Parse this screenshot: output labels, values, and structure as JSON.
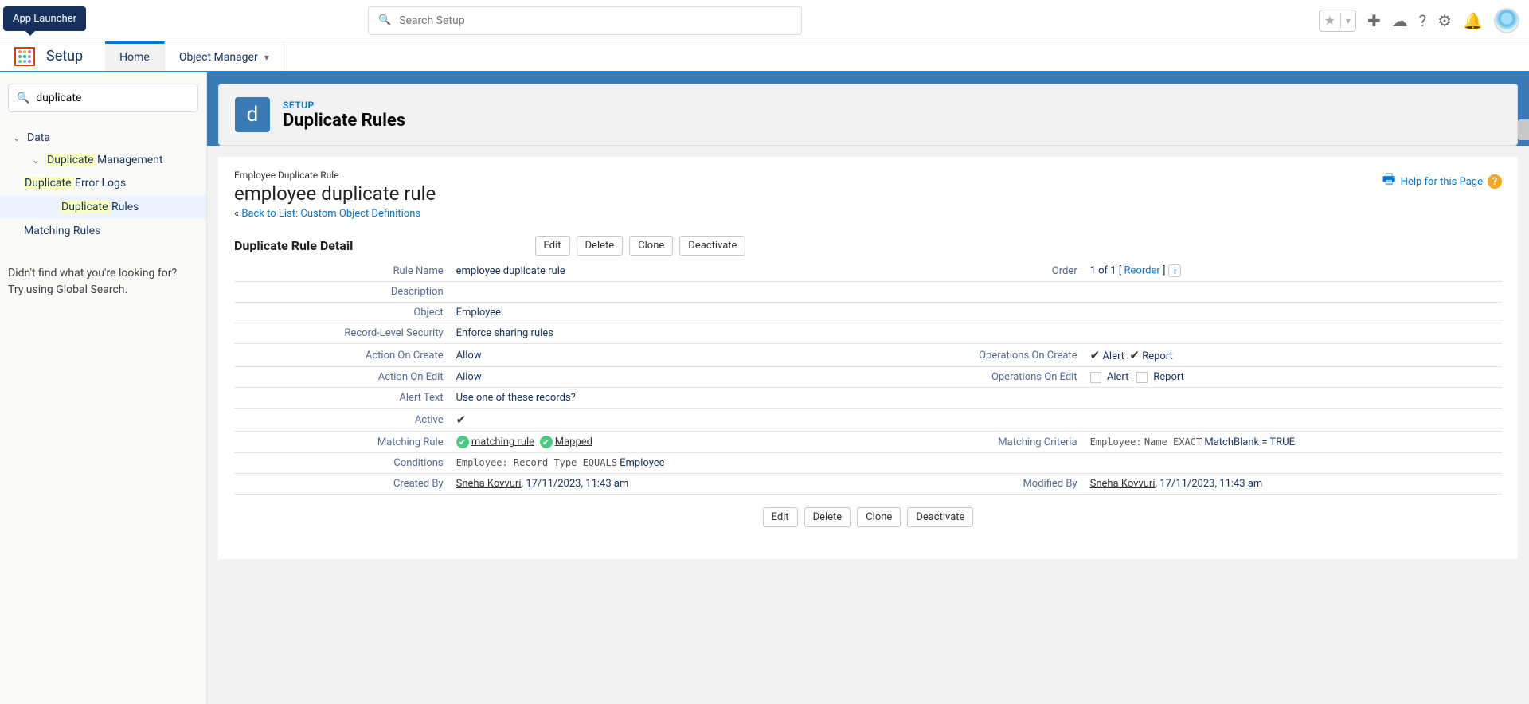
{
  "tooltip": {
    "text": "App Launcher"
  },
  "app": {
    "name": "Setup"
  },
  "tabs": [
    {
      "label": "Home",
      "active": true
    },
    {
      "label": "Object Manager",
      "active": false
    }
  ],
  "globalSearch": {
    "placeholder": "Search Setup"
  },
  "quickFind": {
    "value": "duplicate"
  },
  "tree": {
    "root": "Data",
    "group": "Management",
    "groupPrefix": "Duplicate",
    "items": [
      {
        "hl": "Duplicate",
        "rest": " Error Logs",
        "selected": false
      },
      {
        "hl": "Duplicate",
        "rest": " Rules",
        "selected": true
      },
      {
        "hl": "",
        "rest": "Matching Rules",
        "selected": false
      }
    ],
    "noFind1": "Didn't find what you're looking for?",
    "noFind2": "Try using Global Search."
  },
  "banner": {
    "eyebrow": "SETUP",
    "title": "Duplicate Rules",
    "iconLetter": "d"
  },
  "card": {
    "smallTitle": "Employee Duplicate Rule",
    "title": "employee duplicate rule",
    "backPrefix": "« ",
    "backLink": "Back to List: Custom Object Definitions",
    "helpText": "Help for this Page"
  },
  "sectionTitle": "Duplicate Rule Detail",
  "buttons": {
    "edit": "Edit",
    "delete": "Delete",
    "clone": "Clone",
    "deactivate": "Deactivate"
  },
  "fields": {
    "ruleNameLbl": "Rule Name",
    "ruleName": "employee duplicate rule",
    "orderLbl": "Order",
    "orderPre": "1 of 1 [ ",
    "orderLink": "Reorder",
    "orderPost": " ]",
    "descLbl": "Description",
    "desc": "",
    "objectLbl": "Object",
    "object": "Employee",
    "rlsLbl": "Record-Level Security",
    "rls": "Enforce sharing rules",
    "aocLbl": "Action On Create",
    "aoc": "Allow",
    "oocLbl": "Operations On Create",
    "oocAlert": "Alert",
    "oocReport": "Report",
    "aoeLbl": "Action On Edit",
    "aoe": "Allow",
    "ooeLbl": "Operations On Edit",
    "ooeAlert": "Alert",
    "ooeReport": "Report",
    "alertLbl": "Alert Text",
    "alertText": "Use one of these records?",
    "activeLbl": "Active",
    "mrLbl": "Matching Rule",
    "mrLink1": "matching rule",
    "mrLink2": "Mapped",
    "mcLbl": "Matching Criteria",
    "mcMono1": "Employee:",
    "mcMono2": "Name EXACT",
    "mcTail": " MatchBlank = TRUE",
    "condLbl": "Conditions",
    "condMono": "Employee: Record Type EQUALS",
    "condTail": " Employee",
    "cbLbl": "Created By",
    "cbName": "Sneha Kovvuri",
    "cbDate": ", 17/11/2023, 11:43 am",
    "mbLbl": "Modified By",
    "mbName": "Sneha Kovvuri",
    "mbDate": ", 17/11/2023, 11:43 am"
  }
}
